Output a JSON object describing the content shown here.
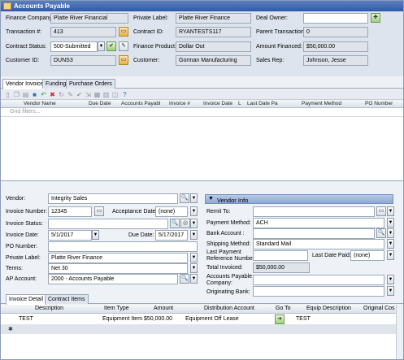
{
  "window": {
    "title": "Accounts Payable"
  },
  "header": {
    "finance_company": {
      "label": "Finance Company:",
      "value": "Platte River Financial"
    },
    "transaction": {
      "label": "Transaction #:",
      "value": "413"
    },
    "contract_status": {
      "label": "Contract Status:",
      "value": "500-Submitted"
    },
    "customer_id": {
      "label": "Customer ID:",
      "value": "DUNS3"
    },
    "private_label": {
      "label": "Private Label:",
      "value": "Platte River Finance"
    },
    "contract_id": {
      "label": "Contract ID:",
      "value": "RYANTESTS117"
    },
    "finance_product": {
      "label": "Finance Product:",
      "value": "Dollar Out"
    },
    "customer": {
      "label": "Customer:",
      "value": "Gorman Manufacturing"
    },
    "deal_owner": {
      "label": "Deal Owner:",
      "value": ""
    },
    "parent_transaction": {
      "label": "Parent Transaction:",
      "value": "0"
    },
    "amount_financed": {
      "label": "Amount Financed:",
      "value": "$50,000.00"
    },
    "sales_rep": {
      "label": "Sales Rep:",
      "value": "Johnson, Jesse"
    }
  },
  "tabs": [
    {
      "label": "Vendor Invoice"
    },
    {
      "label": "Funding"
    },
    {
      "label": "Purchase Orders"
    }
  ],
  "grid": {
    "columns": [
      "Vendor Name",
      "Due Date",
      "Accounts Payabl",
      "Invoice #",
      "Invoice Date",
      "L",
      "Last Date Pa",
      "Payment Method",
      "PO Number"
    ],
    "filter_placeholder": "Grid filters..."
  },
  "form": {
    "vendor": {
      "label": "Vendor:",
      "value": "Integrity Sales"
    },
    "invoice_number": {
      "label": "Invoice Number:",
      "value": "12345"
    },
    "acceptance_date": {
      "label": "Acceptance Date:",
      "value": "(none)"
    },
    "invoice_status": {
      "label": "Invoice Status:",
      "value": ""
    },
    "invoice_date": {
      "label": "Invoice Date:",
      "value": "5/1/2017"
    },
    "due_date": {
      "label": "Due Date:",
      "value": "5/17/2017"
    },
    "po_number": {
      "label": "PO Number:",
      "value": ""
    },
    "private_label": {
      "label": "Private Label:",
      "value": "Platte River Finance"
    },
    "terms": {
      "label": "Terms:",
      "value": "Net 30"
    },
    "ap_account": {
      "label": "AP Account:",
      "value": "2000 - Accounts Payable"
    }
  },
  "vendor_info": {
    "title": "Vendor Info",
    "remit_to": {
      "label": "Remit To:",
      "value": ""
    },
    "payment_method": {
      "label": "Payment Method:",
      "value": "ACH"
    },
    "bank_account": {
      "label": "Bank Account :",
      "value": ""
    },
    "shipping_method": {
      "label": "Shipping Method:",
      "value": "Standard Mail"
    },
    "last_payment_ref": {
      "label1": "Last Payment",
      "label2": "Reference Number:",
      "value": ""
    },
    "last_date_paid": {
      "label": "Last Date Paid:",
      "value": "(none)"
    },
    "total_invoiced": {
      "label": "Total Invoiced:",
      "value": "$50,000.00"
    },
    "ap_company": {
      "label1": "Accounts Payable",
      "label2": "Company:",
      "value": ""
    },
    "originating_bank": {
      "label": "Originating Bank:",
      "value": ""
    }
  },
  "sub_tabs": [
    {
      "label": "Invoice Detail"
    },
    {
      "label": "Contract Items"
    }
  ],
  "detail": {
    "columns": [
      "Description",
      "Item Type",
      "Amount",
      "Distribution Account",
      "Go To",
      "Equip Description",
      "Original Cos"
    ],
    "rows": [
      {
        "description": "TEST",
        "item_type": "Equipment Item",
        "amount": "$50,000.00",
        "distribution_account": "Equipment Off Lease",
        "equip_description": "TEST"
      }
    ]
  },
  "colors": {
    "title_bar": "#2f5aa8",
    "vendor_info_bar": "#8eaad6"
  }
}
